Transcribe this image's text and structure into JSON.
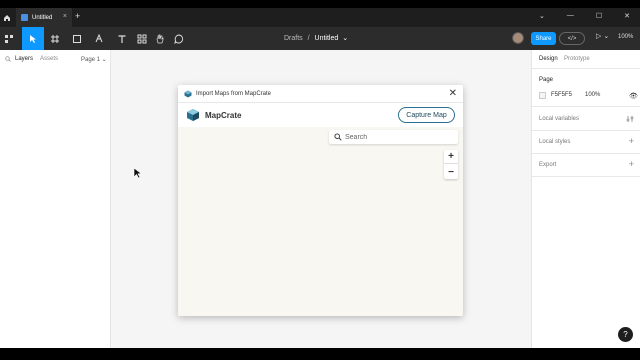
{
  "titlebar": {
    "tab_label": "Untitled",
    "tab_close": "×",
    "new_tab": "+",
    "win_controls": [
      "⌄",
      "—",
      "☐",
      "✕"
    ]
  },
  "toolbar": {
    "breadcrumb_parent": "Drafts",
    "breadcrumb_sep": "/",
    "file_title": "Untitled",
    "file_title_chevron": "⌄",
    "share_label": "Share",
    "dev_label": "</>",
    "play_label": "▷ ⌄",
    "zoom_level": "100%"
  },
  "left_panel": {
    "tab_layers": "Layers",
    "tab_assets": "Assets",
    "page_selector": "Page 1 ⌄"
  },
  "dialog": {
    "title": "Import Maps from MapCrate",
    "close": "✕",
    "brand_name": "MapCrate",
    "capture_label": "Capture Map",
    "search_placeholder": "Search",
    "zoom_in": "+",
    "zoom_out": "−"
  },
  "right_panel": {
    "tab_design": "Design",
    "tab_prototype": "Prototype",
    "page_label": "Page",
    "page_color_hex": "F5F5F5",
    "page_color_opacity": "100%",
    "local_variables": "Local variables",
    "local_styles": "Local styles",
    "export": "Export",
    "plus": "+",
    "eye": "👁"
  },
  "help_label": "?",
  "colors": {
    "accent": "#0d99ff",
    "chrome_dark": "#2c2c2c",
    "canvas_bg": "#f5f5f5",
    "map_bg": "#f8f7f2",
    "capture_border": "#2a6f8f"
  }
}
